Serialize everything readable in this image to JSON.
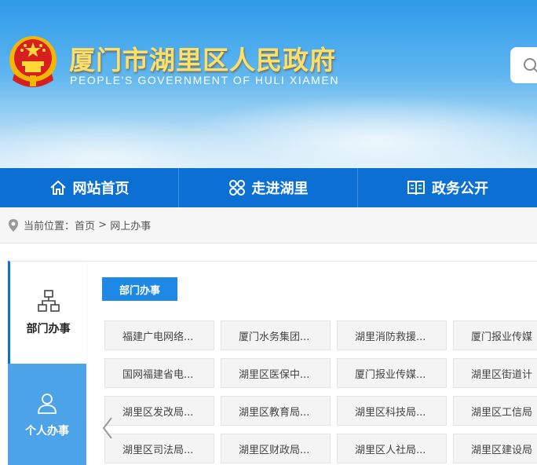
{
  "header": {
    "title": "厦门市湖里区人民政府",
    "subtitle": "PEOPLE'S GOVERNMENT OF HULI XIAMEN",
    "emblem_icon": "national-emblem-icon",
    "search_icon": "search-icon"
  },
  "nav": [
    {
      "label": "网站首页",
      "icon": "home-icon"
    },
    {
      "label": "走进湖里",
      "icon": "clover-grid-icon"
    },
    {
      "label": "政务公开",
      "icon": "open-book-icon"
    }
  ],
  "breadcrumb": {
    "prefix": "当前位置：",
    "home": "首页",
    "separator": ">",
    "current": "网上办事"
  },
  "left_tabs": [
    {
      "label": "部门办事",
      "icon": "org-chart-icon",
      "active": true
    },
    {
      "label": "个人办事",
      "icon": "person-icon",
      "active": false
    }
  ],
  "section": {
    "title": "部门办事"
  },
  "departments": [
    [
      "福建广电网络...",
      "厦门水务集团...",
      "湖里消防救援...",
      "厦门报业传媒"
    ],
    [
      "国网福建省电...",
      "湖里区医保中...",
      "厦门报业传媒...",
      "湖里区街道计"
    ],
    [
      "湖里区发改局...",
      "湖里区教育局...",
      "湖里区科技局...",
      "湖里区工信局"
    ],
    [
      "湖里区司法局...",
      "湖里区财政局...",
      "湖里区人社局...",
      "湖里区建设局"
    ]
  ],
  "colors": {
    "nav_bg": "#0b6fd4",
    "accent": "#1e88e5",
    "title_gold": "#ffe066",
    "inactive_tab": "#4da3e8"
  }
}
